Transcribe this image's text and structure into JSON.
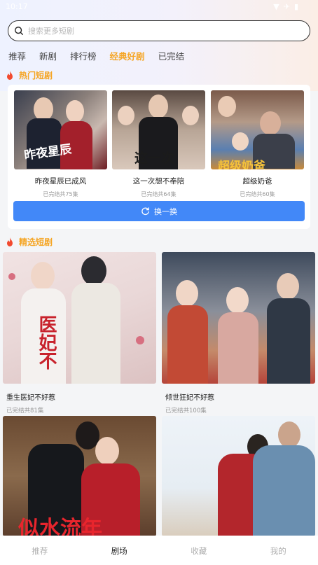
{
  "status_bar": {
    "time": "10:17"
  },
  "search": {
    "placeholder": "搜索更多短剧"
  },
  "tabs": [
    "推荐",
    "新剧",
    "排行榜",
    "经典好剧",
    "已完结"
  ],
  "active_tab": "经典好剧",
  "hot_section": {
    "title": "热门短剧",
    "items": [
      {
        "title": "昨夜星辰已成风",
        "meta": "已完结共75集",
        "cover_text": "昨夜星辰"
      },
      {
        "title": "这一次想不奉陪",
        "meta": "已完结共64集",
        "cover_text": "这一次"
      },
      {
        "title": "超级奶爸",
        "meta": "已完结共60集",
        "cover_text": "超级奶爸"
      }
    ],
    "refresh_label": "换一换"
  },
  "picked_section": {
    "title": "精选短剧",
    "items": [
      {
        "title": "重生医妃不好惹",
        "meta": "已完结共81集",
        "cover_text": "医妃不"
      },
      {
        "title": "倾世狂妃不好惹",
        "meta": "已完结共100集",
        "cover_text": ""
      },
      {
        "title": "",
        "meta": "",
        "cover_text": "似水流年"
      },
      {
        "title": "",
        "meta": "",
        "cover_text": ""
      }
    ]
  },
  "bottom_nav": [
    "推荐",
    "剧场",
    "收藏",
    "我的"
  ],
  "active_nav": "剧场",
  "colors": {
    "accent": "#f5a524",
    "button": "#4288f8",
    "fire": "#f24a2f",
    "inactive_nav": "#b0b0b0"
  }
}
